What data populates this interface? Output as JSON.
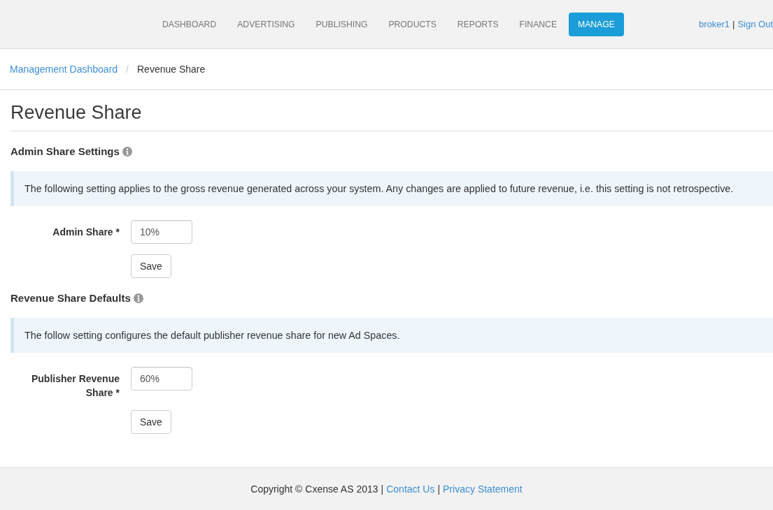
{
  "nav": {
    "items": [
      {
        "label": "DASHBOARD",
        "selected": false
      },
      {
        "label": "ADVERTISING",
        "selected": false
      },
      {
        "label": "PUBLISHING",
        "selected": false
      },
      {
        "label": "PRODUCTS",
        "selected": false
      },
      {
        "label": "REPORTS",
        "selected": false
      },
      {
        "label": "FINANCE",
        "selected": false
      },
      {
        "label": "MANAGE",
        "selected": true
      }
    ],
    "user": {
      "username": "broker1",
      "separator": "|",
      "sign_out": "Sign Out"
    }
  },
  "breadcrumb": {
    "items": [
      {
        "label": "Management Dashboard",
        "kind": "link"
      },
      {
        "label": "Revenue Share",
        "kind": "current"
      }
    ],
    "separator": "/"
  },
  "page_title": "Revenue Share",
  "sections": [
    {
      "heading": "Admin Share Settings",
      "info": "The following setting applies to the gross revenue generated across your system. Any changes are applied to future revenue, i.e. this setting is not retrospective.",
      "fields": [
        {
          "label": "Admin Share *",
          "value": "10%"
        }
      ],
      "button": "Save"
    },
    {
      "heading": "Revenue Share Defaults",
      "info": "The follow setting configures the default publisher revenue share for new Ad Spaces.",
      "fields": [
        {
          "label": "Publisher Revenue Share *",
          "value": "60%"
        }
      ],
      "button": "Save"
    }
  ],
  "footer": {
    "copyright": "Copyright © Cxense AS 2013",
    "separator": "|",
    "links": [
      "Contact Us",
      "Privacy Statement"
    ]
  }
}
